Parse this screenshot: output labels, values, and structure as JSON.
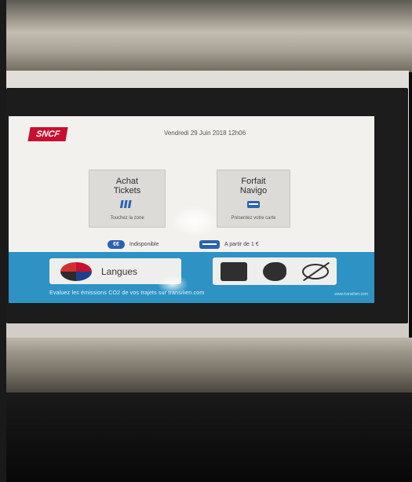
{
  "header": {
    "logo_text": "SNCF",
    "datetime": "Vendredi 29 Juin 2018 12h06"
  },
  "tiles": [
    {
      "title_line1": "Achat",
      "title_line2": "Tickets",
      "subtitle": "Touchez la zone",
      "icon": "ticket-icon"
    },
    {
      "title_line1": "Forfait",
      "title_line2": "Navigo",
      "subtitle": "Présentez votre carte",
      "icon": "pass-card-icon"
    }
  ],
  "payment": {
    "coins_label": "Indisponible",
    "cards_label": "A partir de 1 €",
    "coins_icon": "coins-icon",
    "cards_icon": "bank-card-icon"
  },
  "bottom": {
    "langues_label": "Langues",
    "footer_text": "Evaluez les émissions CO2 de vos trajets sur transilien.com",
    "footer_url": "www.transilien.com",
    "accessibility_icons": [
      "hearing-impaired-icon",
      "cognitive-disability-icon",
      "visually-impaired-icon"
    ]
  },
  "colors": {
    "brand_red": "#c8102e",
    "band_blue": "#2e93c4",
    "icon_blue": "#2a63b0"
  }
}
